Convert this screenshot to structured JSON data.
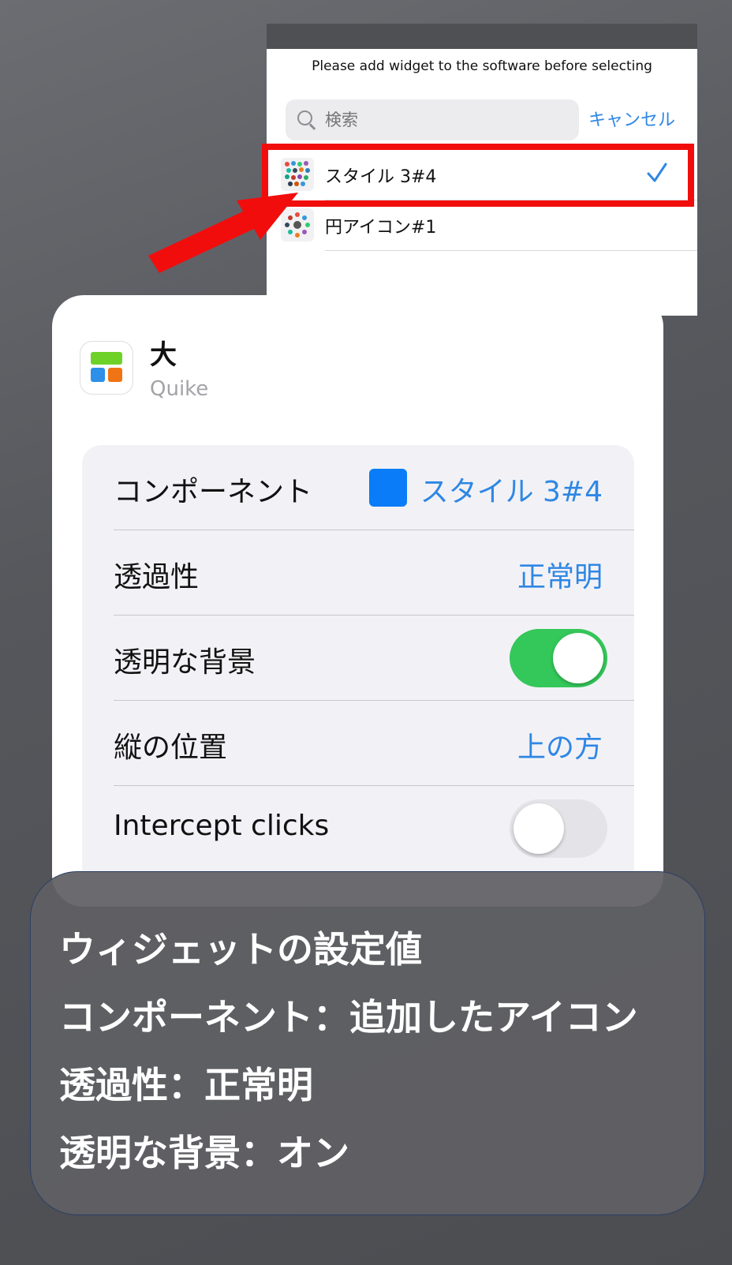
{
  "picker": {
    "title": "Please add widget to the software before selecting",
    "search_placeholder": "検索",
    "cancel_label": "キャンセル",
    "items": [
      {
        "label": "スタイル 3#4",
        "selected": true
      },
      {
        "label": "円アイコン#1",
        "selected": false
      }
    ]
  },
  "widget": {
    "size_label": "大",
    "app_name": "Quike",
    "settings": {
      "component_label": "コンポーネント",
      "component_value": "スタイル 3#4",
      "component_color": "#0a7cf7",
      "opacity_label": "透過性",
      "opacity_value": "正常明",
      "transparent_bg_label": "透明な背景",
      "transparent_bg_on": true,
      "vertical_position_label": "縦の位置",
      "vertical_position_value": "上の方",
      "intercept_clicks_label": "Intercept clicks",
      "intercept_clicks_on": false
    }
  },
  "caption": {
    "lines": [
      "ウィジェットの設定値",
      "コンポーネント：追加したアイコン",
      "透過性：正常明",
      "透明な背景：オン"
    ]
  },
  "colors": {
    "accent_blue": "#2f87e4",
    "toggle_on": "#34c759",
    "highlight_red": "#f20d0d"
  },
  "icons": [
    "search-icon",
    "checkmark-icon",
    "app-icon",
    "annotation-arrow"
  ]
}
